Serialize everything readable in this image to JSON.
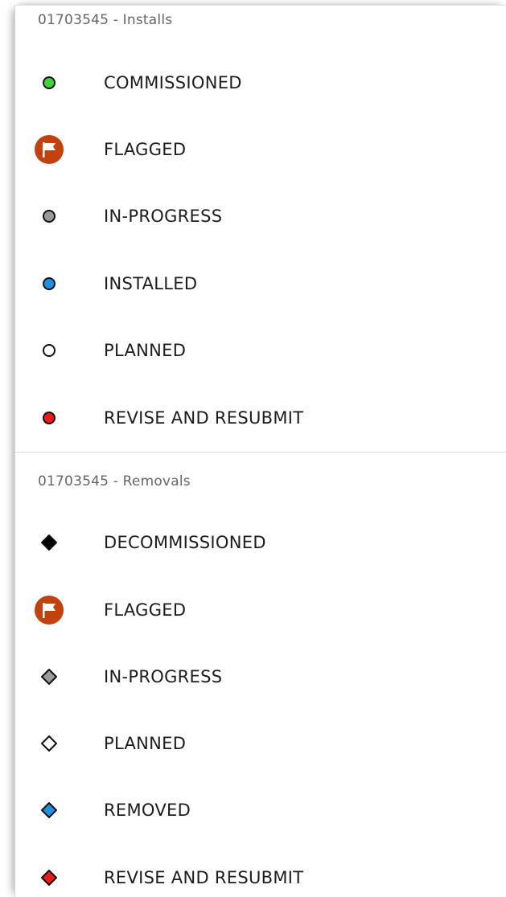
{
  "installs": {
    "title": "01703545 - Installs",
    "items": [
      {
        "label": "COMMISSIONED",
        "icon": "green-circle-icon",
        "color": "#3bd43b"
      },
      {
        "label": "FLAGGED",
        "icon": "flag-icon",
        "color": "#c2410c"
      },
      {
        "label": "IN-PROGRESS",
        "icon": "gray-circle-icon",
        "color": "#9a9a9a"
      },
      {
        "label": "INSTALLED",
        "icon": "blue-circle-icon",
        "color": "#1e90e0"
      },
      {
        "label": "PLANNED",
        "icon": "white-circle-icon",
        "color": "#ffffff"
      },
      {
        "label": "REVISE AND RESUBMIT",
        "icon": "red-circle-icon",
        "color": "#f01818"
      }
    ]
  },
  "removals": {
    "title": "01703545 - Removals",
    "items": [
      {
        "label": "DECOMMISSIONED",
        "icon": "black-diamond-icon",
        "color": "#000000"
      },
      {
        "label": "FLAGGED",
        "icon": "flag-icon",
        "color": "#c2410c"
      },
      {
        "label": "IN-PROGRESS",
        "icon": "gray-diamond-icon",
        "color": "#9a9a9a"
      },
      {
        "label": "PLANNED",
        "icon": "white-diamond-icon",
        "color": "#ffffff"
      },
      {
        "label": "REMOVED",
        "icon": "blue-diamond-icon",
        "color": "#1e90e0"
      },
      {
        "label": "REVISE AND RESUBMIT",
        "icon": "red-diamond-icon",
        "color": "#f01818"
      }
    ]
  }
}
